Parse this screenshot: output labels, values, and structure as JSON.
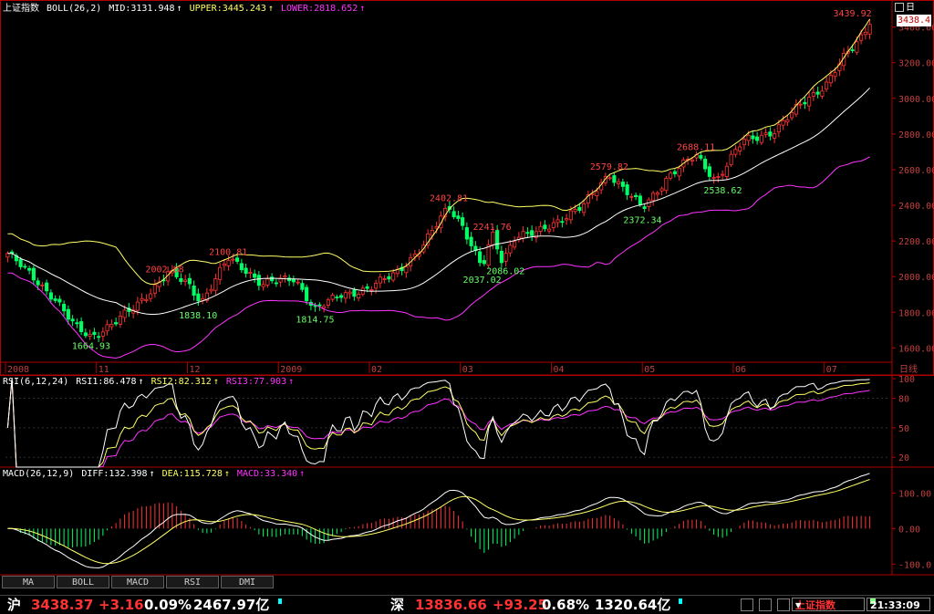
{
  "main_panel": {
    "index_name": "上证指数",
    "indicator": "BOLL(26,2)",
    "mid_label": "MID:3131.948",
    "upper_label": "UPPER:3445.243",
    "lower_label": "LOWER:2818.652",
    "arrow": "↑",
    "current_price_label": "3438.4",
    "period_label": "日",
    "period_axis_label": "日线",
    "colors": {
      "mid": "#ffffff",
      "upper": "#ffff66",
      "lower": "#ff33ff",
      "up": "#ff3333",
      "down": "#00ff66",
      "axis": "#b00000"
    }
  },
  "rsi_panel": {
    "label": "RSI(6,12,24)",
    "rsi1": "RSI1:86.478",
    "rsi2": "RSI2:82.312",
    "rsi3": "RSI3:77.903"
  },
  "macd_panel": {
    "label": "MACD(26,12,9)",
    "diff": "DIFF:132.398",
    "dea": "DEA:115.728",
    "macd": "MACD:33.340"
  },
  "tabs": [
    "MA",
    "BOLL",
    "MACD",
    "RSI",
    "DMI"
  ],
  "status": {
    "sh_name": "沪",
    "sh_price": "3438.37",
    "sh_change": "+3.16",
    "sh_pct": "0.09%",
    "sh_amount": "2467.97亿",
    "sz_name": "深",
    "sz_price": "13836.66",
    "sz_change": "+93.25",
    "sz_pct": "0.68%",
    "sz_amount": "1320.64亿",
    "index_box": "上证指数",
    "time": "21:33:09"
  },
  "chart_data": [
    {
      "type": "candlestick",
      "x_ticks": [
        "2008",
        "11",
        "12",
        "2009",
        "02",
        "03",
        "04",
        "05",
        "06",
        "07"
      ],
      "y_ticks": [
        1600,
        1800,
        2000,
        2200,
        2400,
        2600,
        2800,
        3000,
        3200,
        3400
      ],
      "ylim": [
        1520,
        3480
      ],
      "n_bars": 200,
      "close_path": [
        [
          0,
          2130
        ],
        [
          8,
          1990
        ],
        [
          14,
          1880
        ],
        [
          20,
          1720
        ],
        [
          25,
          1665
        ],
        [
          32,
          1740
        ],
        [
          38,
          1830
        ],
        [
          48,
          2020
        ],
        [
          54,
          1960
        ],
        [
          58,
          1860
        ],
        [
          66,
          2100
        ],
        [
          72,
          2030
        ],
        [
          76,
          1960
        ],
        [
          86,
          1990
        ],
        [
          92,
          1815
        ],
        [
          100,
          1900
        ],
        [
          108,
          1930
        ],
        [
          116,
          2020
        ],
        [
          124,
          2160
        ],
        [
          132,
          2400
        ],
        [
          136,
          2290
        ],
        [
          142,
          2040
        ],
        [
          145,
          2240
        ],
        [
          148,
          2090
        ],
        [
          152,
          2230
        ],
        [
          158,
          2240
        ],
        [
          166,
          2330
        ],
        [
          172,
          2390
        ],
        [
          180,
          2580
        ],
        [
          186,
          2460
        ],
        [
          190,
          2380
        ],
        [
          198,
          2570
        ],
        [
          206,
          2680
        ],
        [
          212,
          2540
        ],
        [
          220,
          2760
        ],
        [
          230,
          2820
        ],
        [
          238,
          2980
        ],
        [
          245,
          3080
        ],
        [
          250,
          3220
        ],
        [
          256,
          3360
        ],
        [
          258,
          3440
        ]
      ],
      "annotations": [
        {
          "text": "3439.92",
          "index": 258,
          "value": 3439.92,
          "kind": "high"
        },
        {
          "text": "2002.88",
          "index": 47,
          "value": 2002.88,
          "kind": "high"
        },
        {
          "text": "2100.81",
          "index": 66,
          "value": 2100.81,
          "kind": "high"
        },
        {
          "text": "2402.81",
          "index": 132,
          "value": 2402.81,
          "kind": "high"
        },
        {
          "text": "2241.76",
          "index": 145,
          "value": 2241.76,
          "kind": "high"
        },
        {
          "text": "2579.82",
          "index": 180,
          "value": 2579.82,
          "kind": "high"
        },
        {
          "text": "2688.11",
          "index": 206,
          "value": 2688.11,
          "kind": "high"
        },
        {
          "text": "1664.93",
          "index": 25,
          "value": 1664.93,
          "kind": "low"
        },
        {
          "text": "1838.10",
          "index": 57,
          "value": 1838.1,
          "kind": "low"
        },
        {
          "text": "1814.75",
          "index": 92,
          "value": 1814.75,
          "kind": "low"
        },
        {
          "text": "2037.02",
          "index": 142,
          "value": 2037.02,
          "kind": "low"
        },
        {
          "text": "2086.02",
          "index": 149,
          "value": 2086.02,
          "kind": "low"
        },
        {
          "text": "2372.34",
          "index": 190,
          "value": 2372.34,
          "kind": "low"
        },
        {
          "text": "2538.62",
          "index": 214,
          "value": 2538.62,
          "kind": "low"
        }
      ],
      "series": [
        {
          "name": "MID",
          "last": 3131.948
        },
        {
          "name": "UPPER",
          "last": 3445.243
        },
        {
          "name": "LOWER",
          "last": 2818.652
        }
      ]
    },
    {
      "type": "line",
      "y_ticks": [
        20,
        50,
        80,
        100
      ],
      "ylim": [
        10,
        100
      ],
      "series": [
        {
          "name": "RSI1",
          "last": 86.478
        },
        {
          "name": "RSI2",
          "last": 82.312
        },
        {
          "name": "RSI3",
          "last": 77.903
        }
      ]
    },
    {
      "type": "line",
      "y_ticks": [
        100,
        0,
        -100
      ],
      "y_tick_labels": [
        "100.00",
        "0.00",
        "-100.0"
      ],
      "ylim": [
        -130,
        160
      ],
      "series": [
        {
          "name": "DIFF",
          "last": 132.398
        },
        {
          "name": "DEA",
          "last": 115.728
        },
        {
          "name": "MACD",
          "last": 33.34
        }
      ]
    }
  ]
}
